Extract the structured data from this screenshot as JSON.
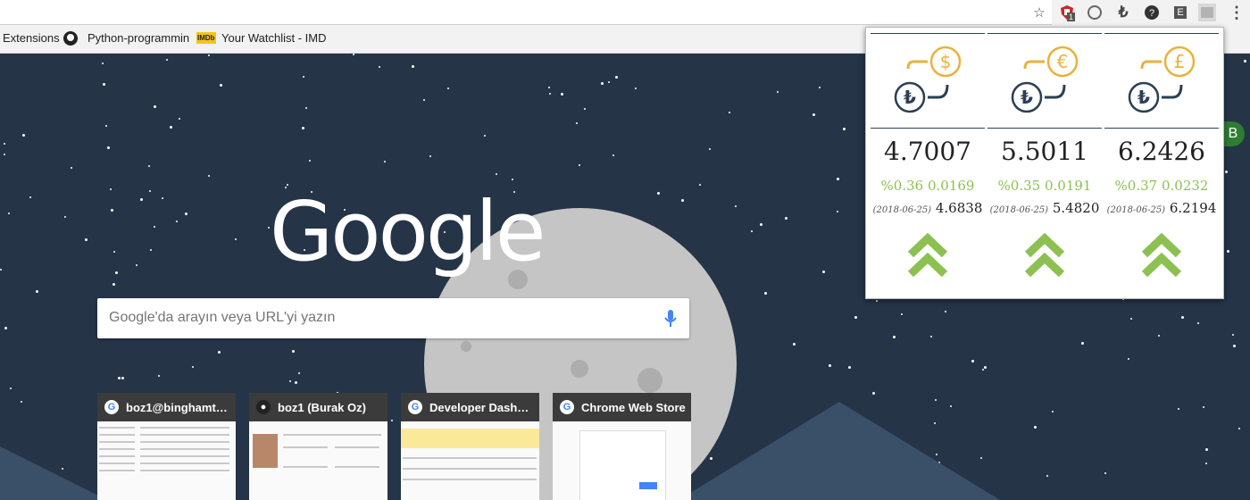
{
  "bookmarks": {
    "extensions": "Extensions",
    "python": "Python-programmin",
    "watchlist": "Your Watchlist - IMD",
    "imdb_badge": "IMDb"
  },
  "toolbar": {
    "badge_count": "1",
    "ext_e_label": "E"
  },
  "ntp": {
    "logo": "Google",
    "search_placeholder": "Google'da arayın veya URL'yi yazın",
    "avatar_letter": "B",
    "tiles": [
      {
        "title": "boz1@binghamton...."
      },
      {
        "title": "boz1 (Burak Oz)"
      },
      {
        "title": "Developer Dashboa..."
      },
      {
        "title": "Chrome Web Store"
      }
    ]
  },
  "popup": {
    "currencies": [
      {
        "symbol": "$",
        "rate": "4.7007",
        "change": "%0.36 0.0169",
        "prev_date": "(2018-06-25)",
        "prev_value": "4.6838"
      },
      {
        "symbol": "€",
        "rate": "5.5011",
        "change": "%0.35 0.0191",
        "prev_date": "(2018-06-25)",
        "prev_value": "5.4820"
      },
      {
        "symbol": "£",
        "rate": "6.2426",
        "change": "%0.37 0.0232",
        "prev_date": "(2018-06-25)",
        "prev_value": "6.2194"
      }
    ],
    "colors": {
      "accent": "#e8b33c",
      "navy": "#2b3f55",
      "up": "#8cc152"
    }
  }
}
